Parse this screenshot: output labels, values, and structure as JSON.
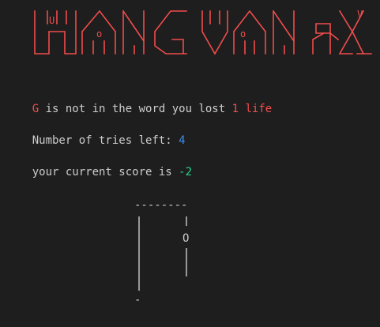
{
  "banner": {
    "color": "#f14c4c",
    "text": "HANGMAN"
  },
  "message": {
    "letter": "G",
    "middle": " is not in the word you lost ",
    "count": "1",
    "suffix": " life"
  },
  "tries": {
    "label": "Number of tries left: ",
    "value": "4"
  },
  "score": {
    "label": "your current score is ",
    "value": "-2"
  },
  "gallows": {
    "top": "--------",
    "head": "O",
    "base": "-"
  },
  "colors": {
    "background": "#1e1e1e",
    "text": "#cccccc",
    "error": "#f14c4c",
    "number": "#3b8eea",
    "score": "#23d18b"
  }
}
